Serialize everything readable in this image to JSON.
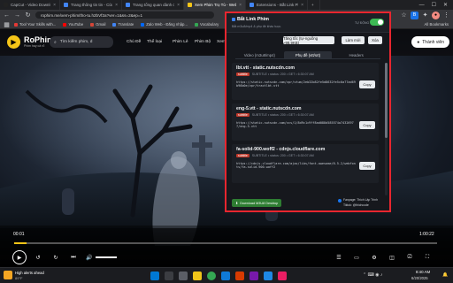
{
  "browser": {
    "tabs": [
      {
        "title": "CapCut - Video Downloader -",
        "color": "#222"
      },
      {
        "title": "Trang thông tin tin - Cửa hàng",
        "color": "#4285f4"
      },
      {
        "title": "Trang tổng quan dành cho nhà",
        "color": "#4285f4"
      },
      {
        "title": "Xem Phim Trọ Tù - Website xe",
        "color": "#f5c518",
        "active": true
      },
      {
        "title": "Extensions - Bắt Link Phim",
        "color": "#4285f4"
      }
    ],
    "url": "rophim.me/xem-phim/tho-tu.h2bVf2a?ver=1&ss=2&ep=1",
    "bookmarks": [
      {
        "label": "Tool Your Skills with...",
        "color": "#e53935"
      },
      {
        "label": "YouTube",
        "color": "#ff0000"
      },
      {
        "label": "Gmail",
        "color": "#d44638"
      },
      {
        "label": "Translate",
        "color": "#4285f4"
      },
      {
        "label": "Zalo Web - Đăng nhập...",
        "color": "#0068ff"
      },
      {
        "label": "Vocabulary",
        "color": "#34a853"
      }
    ],
    "all_bookmarks": "All Bookmarks"
  },
  "site": {
    "logo_name": "RoPhim",
    "logo_sub": "Phim hay cả rổ",
    "search_placeholder": "Tìm kiếm phim, d",
    "menu": [
      "Chủ Đề",
      "Thể loại",
      "Phim Lẻ",
      "Phim Bộ",
      "Xem C"
    ],
    "member_label": "Thành viên"
  },
  "player": {
    "current_time": "00:01",
    "duration": "1:00:22",
    "progress": 0.03
  },
  "popup": {
    "title": "Bắt Link Phim",
    "subtitle": "Bắt m3u8/mp4 & phụ đề khác tuọc.",
    "toggle_label": "TỰ ĐỘNG",
    "actions": [
      "Tăng tốc (tự-nguồng ~98.9KB)",
      "Làm mới",
      "Xóa"
    ],
    "tabs": [
      "Video (m3u8/mp4)",
      "Phụ đề (vtt/srt)",
      "Headers"
    ],
    "active_tab": 1,
    "items": [
      {
        "title": "lbt.vtt - static.nutscdn.com",
        "badge": "subtitle",
        "meta": "SUBTITLE • status: 200 • GET • 6:30:07 AM",
        "url": "https://static.nutscdn.com/vpr/vtum/2eb32b82fe5d8632fe5c0a77ad69b96b0e/vpr/tractlbt.vtt",
        "copy": "Copy"
      },
      {
        "title": "eng-5.vtt - static.nutscdn.com",
        "badge": "subtitle",
        "meta": "SUBTITLE • status: 200 • GET • 6:30:07 AM",
        "url": "https://static.nutscdn.com/vcs/1/8d9c1c9ff8ad088d585574a74326977/eng-5.vtt",
        "copy": "Copy"
      },
      {
        "title": "fa-solid-900.woff2 - cdnjs.cloudflare.com",
        "badge": "subtitle",
        "meta": "SUBTITLE • status: 200 • GET • 6:30:07 AM",
        "url": "https://cdnjs.cloudflare.com/ajax/libs/font-awesome/6.5.2/webfonts/fa-solid-900.woff2",
        "copy": "Copy"
      }
    ],
    "download_label": "Download M3U8 Desktop",
    "credit_1": "Fanpage: Thích Lập Trình",
    "credit_2": "Tiktok: @thichcode"
  },
  "taskbar": {
    "weather_title": "High alerts ahead",
    "weather_sub": "89°F",
    "time": "8:40 AM",
    "date": "6/20/2025"
  }
}
